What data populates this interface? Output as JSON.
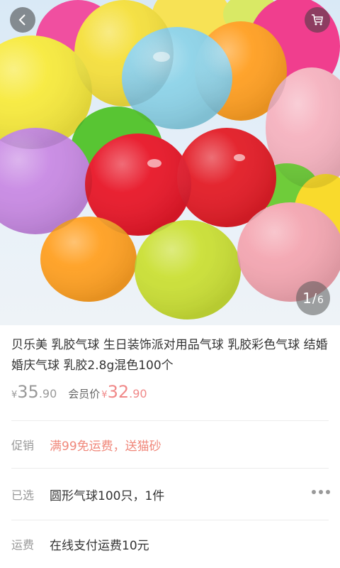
{
  "product": {
    "title": "贝乐美 乳胶气球 生日装饰派对用品气球 乳胶彩色气球 结婚婚庆气球 乳胶2.8g混色100个",
    "currency": "¥",
    "original_price_int": "35",
    "original_price_dec": ".90",
    "member_label": "会员价",
    "member_price_int": "32",
    "member_price_dec": ".90"
  },
  "gallery": {
    "current": "1",
    "separator": "/",
    "total": "6"
  },
  "icons": {
    "back": "back-arrow-icon",
    "cart": "cart-icon",
    "more": "more-dots-icon"
  },
  "rows": {
    "promo": {
      "label": "促销",
      "value": "满99免运费，送猫砂"
    },
    "selected": {
      "label": "已选",
      "value": "圆形气球100只，1件"
    },
    "shipping": {
      "label": "运费",
      "value": "在线支付运费10元"
    }
  },
  "colors": {
    "promo_text": "#f0877a",
    "member_price": "#f08989"
  }
}
